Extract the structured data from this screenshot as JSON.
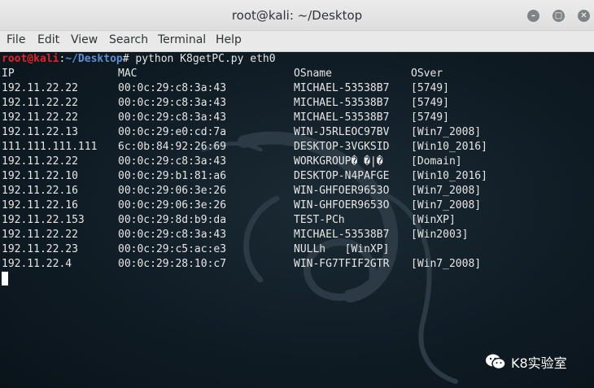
{
  "window": {
    "title": "root@kali: ~/Desktop",
    "controls": [
      "minimize-icon",
      "maximize-icon",
      "close-icon"
    ]
  },
  "menu": [
    "File",
    "Edit",
    "View",
    "Search",
    "Terminal",
    "Help"
  ],
  "terminal": {
    "prompt_user": "root@kali",
    "prompt_sep": ":",
    "prompt_path": "~/Desktop",
    "prompt_symbol": "#",
    "command": " python K8getPC.py eth0",
    "headers": [
      "IP",
      "MAC",
      "OSname",
      "OSver"
    ],
    "rows": [
      [
        "192.11.22.22",
        "00:0c:29:c8:3a:43",
        "MICHAEL-53538B7",
        "[5749]"
      ],
      [
        "192.11.22.22",
        "00:0c:29:c8:3a:43",
        "MICHAEL-53538B7",
        "[5749]"
      ],
      [
        "192.11.22.22",
        "00:0c:29:c8:3a:43",
        "MICHAEL-53538B7",
        "[5749]"
      ],
      [
        "192.11.22.13",
        "00:0c:29:e0:cd:7a",
        "WIN-J5RLEOC97BV",
        "[Win7_2008]"
      ],
      [
        "111.111.111.111",
        "6c:0b:84:92:26:69",
        "DESKTOP-3VGKSID",
        "[Win10_2016]"
      ],
      [
        "192.11.22.22",
        "00:0c:29:c8:3a:43",
        "WORKGROUP� �|�",
        "[Domain]"
      ],
      [
        "192.11.22.10",
        "00:0c:29:b1:81:a6",
        "DESKTOP-N4PAFGE",
        "[Win10_2016]"
      ],
      [
        "192.11.22.16",
        "00:0c:29:06:3e:26",
        "WIN-GHFOER9653O",
        "[Win7_2008]"
      ],
      [
        "192.11.22.16",
        "00:0c:29:06:3e:26",
        "WIN-GHFOER9653O",
        "[Win7_2008]"
      ],
      [
        "192.11.22.153",
        "00:0c:29:8d:b9:da",
        "TEST-PCh",
        "[WinXP]"
      ],
      [
        "192.11.22.22",
        "00:0c:29:c8:3a:43",
        "MICHAEL-53538B7",
        "[Win2003]"
      ],
      [
        "192.11.22.23",
        "00:0c:29:c5:ac:e3",
        "NULLh   [WinXP]",
        ""
      ],
      [
        "192.11.22.4",
        "00:0c:29:28:10:c7",
        "WIN-FG7TFIF2GTR",
        "[Win7_2008]"
      ]
    ]
  },
  "watermark": {
    "icon": "wechat-icon",
    "text": "K8实验室"
  },
  "colors": {
    "prompt_user": "#e0242a",
    "prompt_path": "#5c8fd6",
    "terminal_bg": "#0f1b23",
    "text": "#e6e6e6"
  }
}
